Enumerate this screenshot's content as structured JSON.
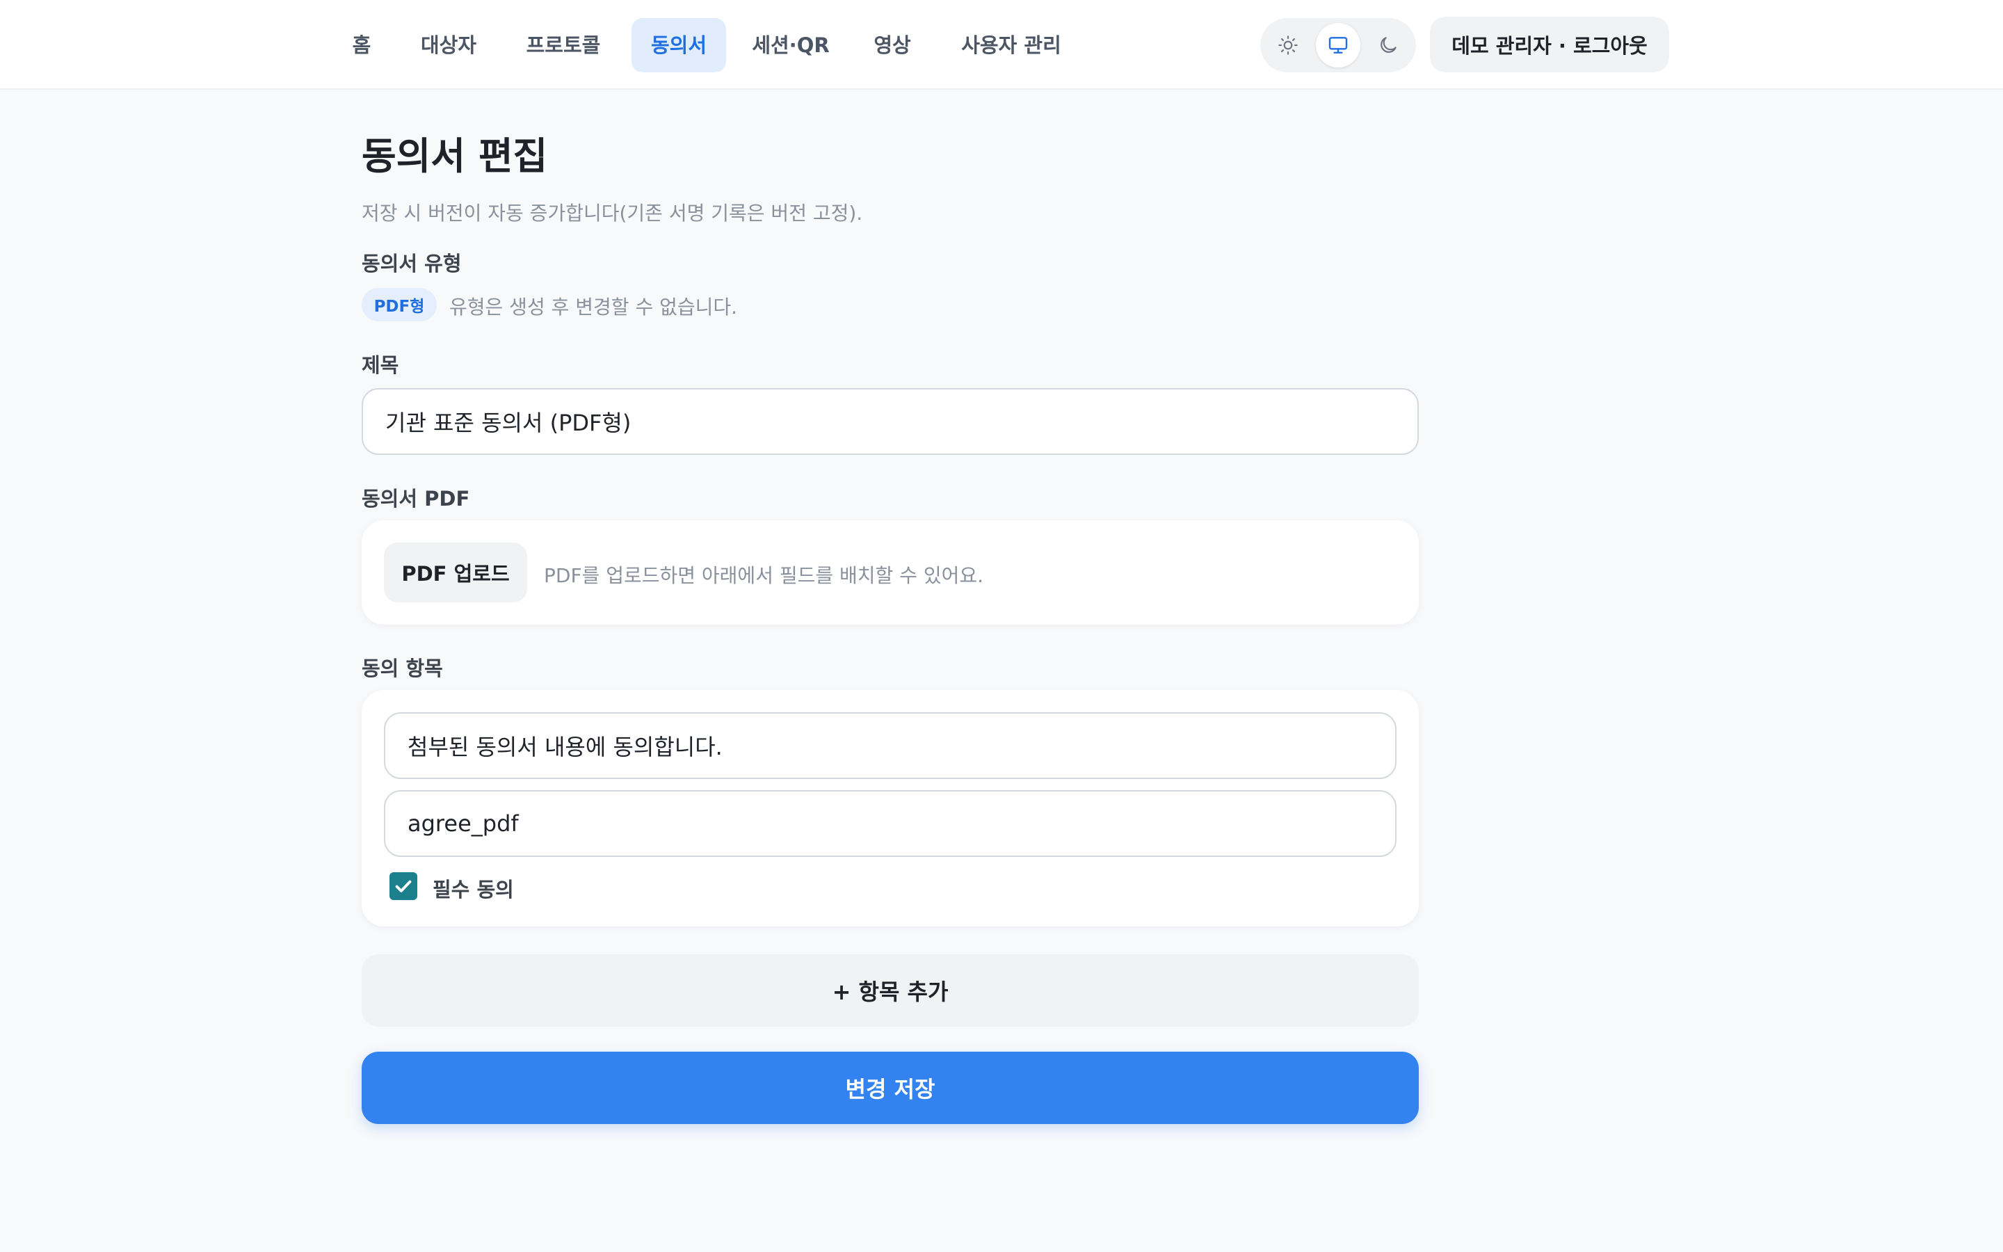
{
  "nav": {
    "items": [
      {
        "label": "홈"
      },
      {
        "label": "대상자"
      },
      {
        "label": "프로토콜"
      },
      {
        "label": "동의서",
        "active": true
      },
      {
        "label": "세션·QR"
      },
      {
        "label": "영상"
      },
      {
        "label": "사용자 관리"
      }
    ],
    "theme_options": [
      "sun-icon",
      "monitor-icon",
      "moon-icon"
    ],
    "theme_selected": "monitor-icon",
    "account_label": "데모 관리자 · 로그아웃"
  },
  "page": {
    "title": "동의서 편집",
    "subtitle": "저장 시 버전이 자동 증가합니다(기존 서명 기록은 버전 고정)."
  },
  "consent_type": {
    "label": "동의서 유형",
    "badge": "PDF형",
    "note": "유형은 생성 후 변경할 수 없습니다."
  },
  "title_field": {
    "label": "제목",
    "value": "기관 표준 동의서 (PDF형)"
  },
  "pdf": {
    "label": "동의서 PDF",
    "upload_button": "PDF 업로드",
    "note": "PDF를 업로드하면 아래에서 필드를 배치할 수 있어요."
  },
  "items": {
    "label": "동의 항목",
    "list": [
      {
        "text": "첨부된 동의서 내용에 동의합니다.",
        "key": "agree_pdf",
        "required": true,
        "required_label": "필수 동의"
      }
    ],
    "add_button": "+ 항목 추가"
  },
  "save_button": "변경 저장",
  "colors": {
    "accent": "#3282f0",
    "nav_active_bg": "#e1edfd",
    "nav_active_text": "#1f6fe0",
    "checkbox": "#1b7f8c"
  }
}
